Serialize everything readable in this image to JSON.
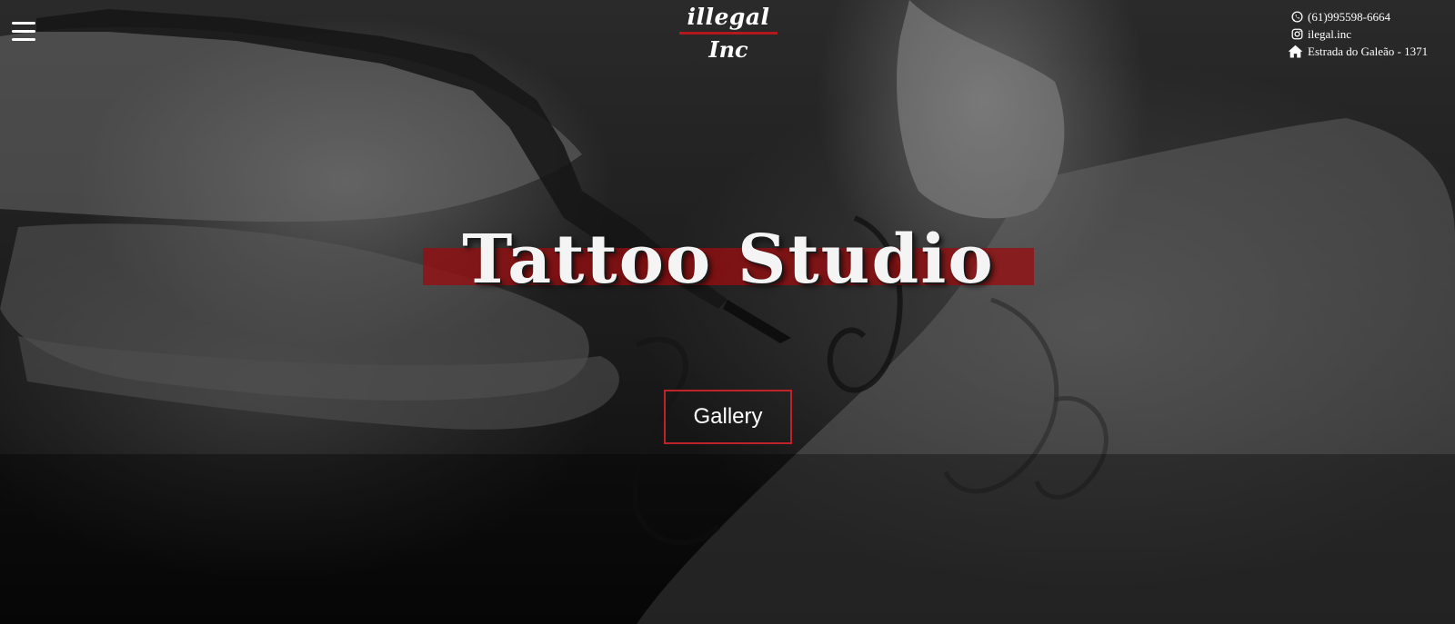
{
  "nav": {
    "menu_icon": "hamburger-menu-icon"
  },
  "logo": {
    "line1": "illegal",
    "line2": "Inc",
    "accent_color": "#b3181c"
  },
  "contact": {
    "phone": "(61)995598-6664",
    "phone_icon": "whatsapp-icon",
    "instagram": "ilegal.inc",
    "instagram_icon": "instagram-icon",
    "address": "Estrada do Galeão - 1371",
    "address_icon": "home-icon"
  },
  "hero": {
    "title": "Tattoo Studio",
    "band_color": "#960e10",
    "cta_label": "Gallery",
    "cta_border_color": "#c0222a"
  }
}
